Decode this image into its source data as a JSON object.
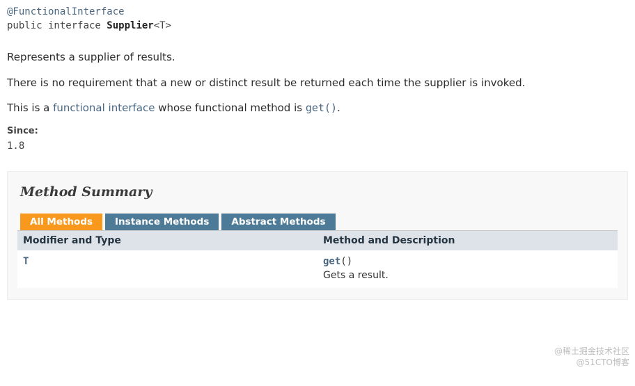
{
  "declaration": {
    "annotation": "@FunctionalInterface",
    "modifiers": "public interface ",
    "typeName": "Supplier",
    "typeParams": "<T>"
  },
  "description": {
    "para1": "Represents a supplier of results.",
    "para2": "There is no requirement that a new or distinct result be returned each time the supplier is invoked.",
    "para3_prefix": "This is a ",
    "para3_link": "functional interface",
    "para3_mid": " whose functional method is ",
    "para3_code": "get()",
    "para3_suffix": "."
  },
  "since": {
    "label": "Since:",
    "value": "1.8"
  },
  "summary": {
    "heading": "Method Summary",
    "tabs": [
      {
        "label": "All Methods",
        "active": true
      },
      {
        "label": "Instance Methods",
        "active": false
      },
      {
        "label": "Abstract Methods",
        "active": false
      }
    ],
    "columns": {
      "c1": "Modifier and Type",
      "c2": "Method and Description"
    },
    "rows": [
      {
        "type": "T",
        "method": "get",
        "params": "()",
        "desc": "Gets a result."
      }
    ]
  },
  "watermark": {
    "line1": "@稀土掘金技术社区",
    "line2": "@51CTO博客"
  }
}
